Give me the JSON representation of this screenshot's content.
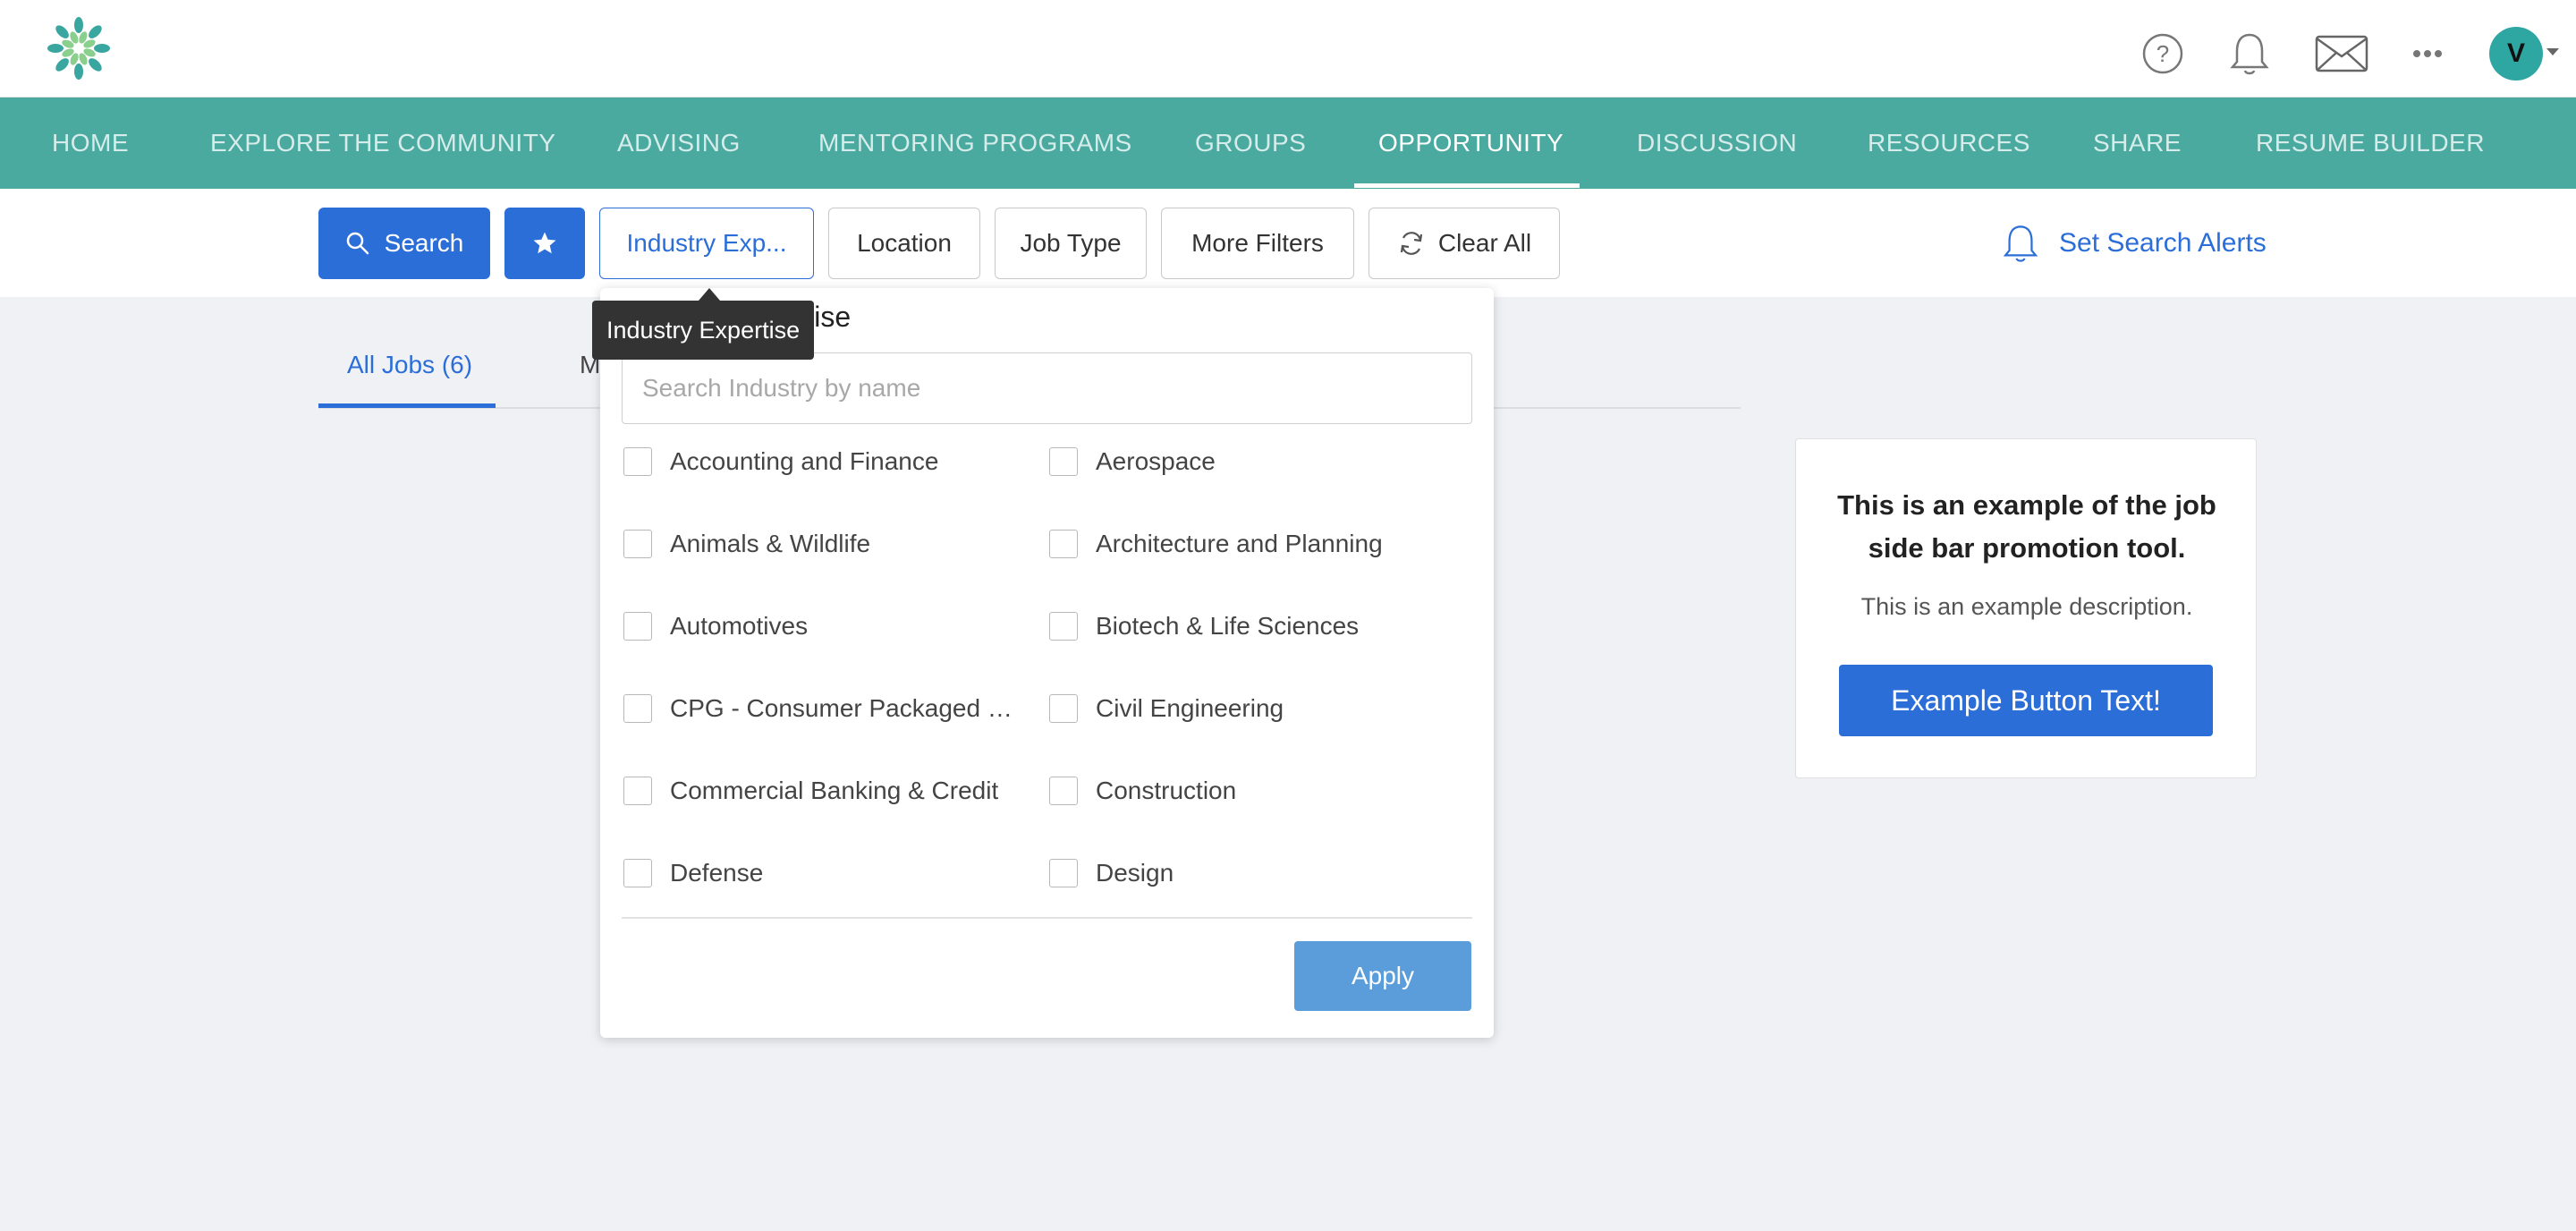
{
  "header": {
    "logo_icon": "flower-logo-icon",
    "icons": [
      "help-icon",
      "bell-icon",
      "mail-icon",
      "more-icon"
    ],
    "avatar_letter": "V"
  },
  "nav": {
    "items": [
      {
        "label": "HOME"
      },
      {
        "label": "EXPLORE THE COMMUNITY"
      },
      {
        "label": "ADVISING"
      },
      {
        "label": "MENTORING PROGRAMS"
      },
      {
        "label": "GROUPS"
      },
      {
        "label": "OPPORTUNITY",
        "active": true
      },
      {
        "label": "DISCUSSION"
      },
      {
        "label": "RESOURCES"
      },
      {
        "label": "SHARE"
      },
      {
        "label": "RESUME BUILDER"
      }
    ]
  },
  "filters": {
    "search_label": "Search",
    "industry_label": "Industry Exp...",
    "location_label": "Location",
    "job_type_label": "Job Type",
    "more_filters_label": "More Filters",
    "clear_all_label": "Clear All",
    "set_alerts_label": "Set Search Alerts"
  },
  "tabs": {
    "all_jobs": "All Jobs (6)",
    "second_tab_partial": "M"
  },
  "tooltip": "Industry Expertise",
  "industry_panel": {
    "title": "Industry Expertise",
    "search_placeholder": "Search Industry by name",
    "options": [
      "Accounting and Finance",
      "Aerospace",
      "Animals & Wildlife",
      "Architecture and Planning",
      "Automotives",
      "Biotech & Life Sciences",
      "CPG - Consumer Packaged G...",
      "Civil Engineering",
      "Commercial Banking & Credit",
      "Construction",
      "Defense",
      "Design"
    ],
    "apply_label": "Apply"
  },
  "promo": {
    "title": "This is an example of the job side bar promotion tool.",
    "description": "This is an example description.",
    "button_label": "Example Button Text!"
  },
  "colors": {
    "nav_bg": "#4aaaa0",
    "primary": "#2b6ed8",
    "apply": "#5b9ddb",
    "avatar": "#2ea6a2"
  }
}
